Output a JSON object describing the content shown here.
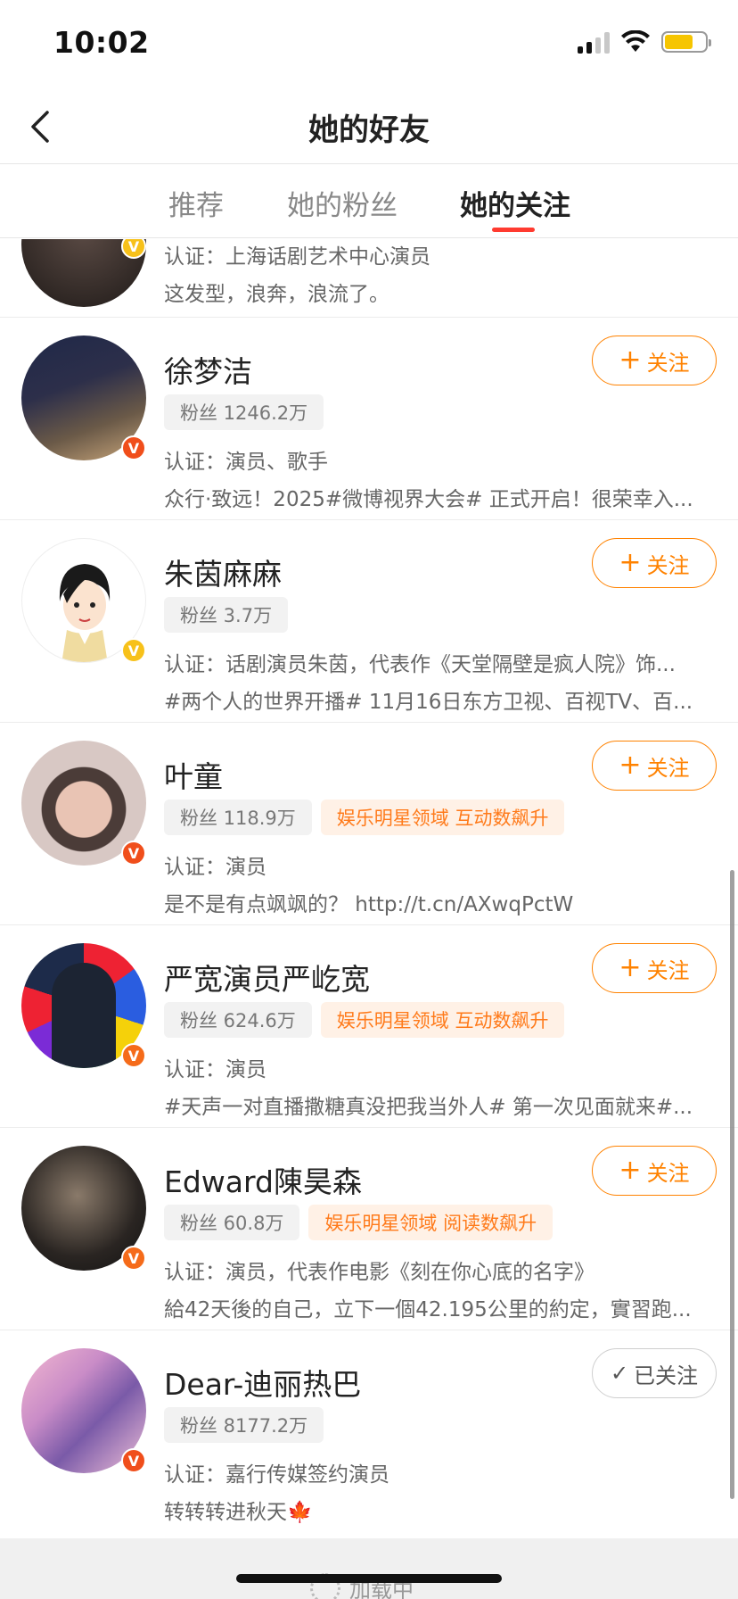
{
  "status_bar": {
    "time": "10:02",
    "battery_color": "#f6c500"
  },
  "nav": {
    "title": "她的好友",
    "back_icon": "chevron-left-icon"
  },
  "tabs": [
    {
      "label": "推荐",
      "active": false
    },
    {
      "label": "她的粉丝",
      "active": false
    },
    {
      "label": "她的关注",
      "active": true
    }
  ],
  "accent_color": "#ff8200",
  "users": [
    {
      "partial": true,
      "cert": "认证：上海话剧艺术中心演员",
      "desc": "这发型，浪奔，浪流了。"
    },
    {
      "name": "徐梦洁",
      "fans": "粉丝 1246.2万",
      "tags": [],
      "cert": "认证：演员、歌手",
      "desc": "众行·致远！2025#微博视界大会# 正式开启！很荣幸入...",
      "button": "关注",
      "followed": false,
      "verified_color": "red"
    },
    {
      "name": "朱茵麻麻",
      "fans": "粉丝 3.7万",
      "tags": [],
      "cert": "认证：话剧演员朱茵，代表作《天堂隔壁是疯人院》饰...",
      "desc": "#两个人的世界开播# 11月16日东方卫视、百视TV、百...",
      "button": "关注",
      "followed": false,
      "verified_color": "gold"
    },
    {
      "name": "叶童",
      "fans": "粉丝 118.9万",
      "tags": [
        "娱乐明星领域 互动数飙升"
      ],
      "cert": "认证：演员",
      "desc": "是不是有点飒飒的？ http://t.cn/AXwqPctW",
      "button": "关注",
      "followed": false,
      "verified_color": "red"
    },
    {
      "name": "严宽演员严屹宽",
      "fans": "粉丝 624.6万",
      "tags": [
        "娱乐明星领域 互动数飙升"
      ],
      "cert": "认证：演员",
      "desc": "#天声一对直播撒糖真没把我当外人# 第一次见面就来#...",
      "button": "关注",
      "followed": false,
      "verified_color": "orange"
    },
    {
      "name": "Edward陳昊森",
      "fans": "粉丝 60.8万",
      "tags": [
        "娱乐明星领域 阅读数飙升"
      ],
      "cert": "认证：演员，代表作电影《刻在你心底的名字》",
      "desc": "給42天後的自己，立下一個42.195公里的約定，實習跑...",
      "button": "关注",
      "followed": false,
      "verified_color": "orange"
    },
    {
      "name": "Dear-迪丽热巴",
      "fans": "粉丝 8177.2万",
      "tags": [],
      "cert": "认证：嘉行传媒签约演员",
      "desc": "转转转进秋天🍁",
      "button": "已关注",
      "followed": true,
      "verified_color": "red"
    }
  ],
  "footer": {
    "loading_text": "加载中"
  }
}
